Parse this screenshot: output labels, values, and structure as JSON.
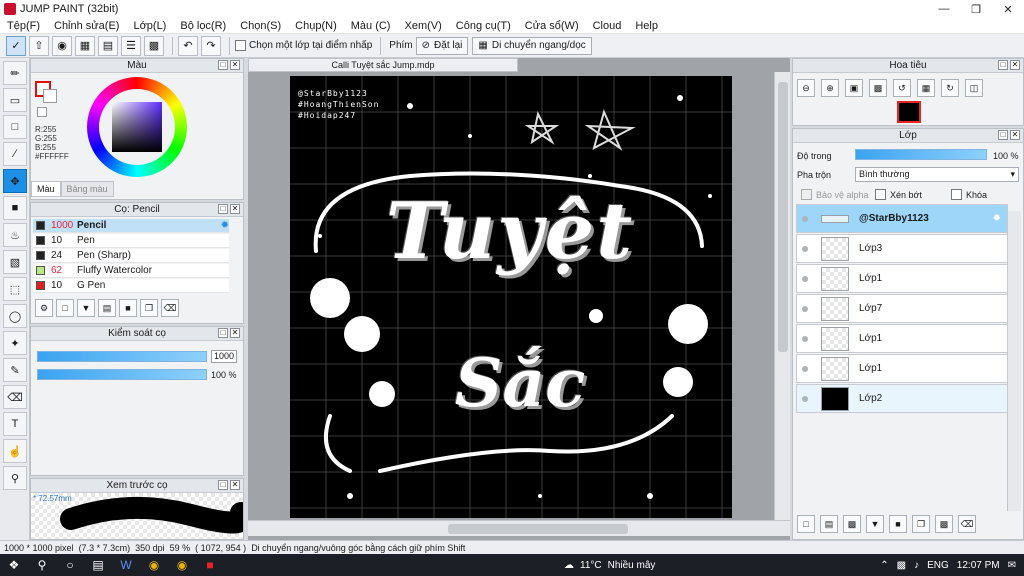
{
  "window": {
    "title": "JUMP PAINT (32bit)"
  },
  "menu": [
    "Tệp(F)",
    "Chỉnh sửa(E)",
    "Lớp(L)",
    "Bộ lọc(R)",
    "Chọn(S)",
    "Chụp(N)",
    "Màu (C)",
    "Xem(V)",
    "Công cụ(T)",
    "Cửa sổ(W)",
    "Cloud",
    "Help"
  ],
  "toolbar": {
    "select_one_layer_label": "Chọn một lớp tại điểm nhấp",
    "pen_label": "Phím",
    "reset_label": "Đặt lại",
    "move_label": "Di chuyển ngang/dọc"
  },
  "color_panel": {
    "title": "Màu",
    "r": "R:255",
    "g": "G:255",
    "b": "B:255",
    "hex": "#FFFFFF",
    "tab_color": "Màu",
    "tab_palette": "Bảng màu"
  },
  "brush_panel": {
    "title": "Cọ: Pencil",
    "items": [
      {
        "size": "1000",
        "name": "Pencil",
        "color": "#222222"
      },
      {
        "size": "10",
        "name": "Pen",
        "color": "#222222"
      },
      {
        "size": "24",
        "name": "Pen (Sharp)",
        "color": "#222222"
      },
      {
        "size": "62",
        "name": "Fluffy Watercolor",
        "color": "#b8e986"
      },
      {
        "size": "10",
        "name": "G Pen",
        "color": "#e02020"
      }
    ]
  },
  "brush_control": {
    "title": "Kiểm soát cọ",
    "size_value": "1000",
    "opacity_value": "100 %",
    "size_fraction": 1.0,
    "opacity_fraction": 1.0
  },
  "brush_preview": {
    "title": "Xem trước cọ",
    "size_mm": "* 72.57mm"
  },
  "document": {
    "tab_title": "Calli Tuyệt sắc Jump.mdp",
    "credits": [
      "@StarBby1123",
      "#HoangThienSon",
      "#Hoidap247"
    ],
    "headline": "Tuyệt",
    "subline": "Sắc"
  },
  "navigator": {
    "title": "Hoa tiêu"
  },
  "layers_panel": {
    "title": "Lớp",
    "opacity_label": "Độ trong",
    "opacity_value": "100 %",
    "opacity_fraction": 1.0,
    "blend_label": "Pha trộn",
    "blend_value": "Bình thường",
    "protect_alpha_label": "Bảo vệ alpha",
    "clipping_label": "Xén bớt",
    "lock_label": "Khóa",
    "layers": [
      {
        "name": "@StarBby1123",
        "thumb": "line"
      },
      {
        "name": "Lớp3",
        "thumb": "transparent"
      },
      {
        "name": "Lớp1",
        "thumb": "transparent"
      },
      {
        "name": "Lớp7",
        "thumb": "transparent"
      },
      {
        "name": "Lớp1",
        "thumb": "transparent"
      },
      {
        "name": "Lớp1",
        "thumb": "transparent"
      },
      {
        "name": "Lớp2",
        "thumb": "black"
      }
    ]
  },
  "status": {
    "dims": "1000 * 1000 pixel",
    "size_cm": "(7.3 * 7.3cm)",
    "dpi": "350 dpi",
    "zoom": "59 %",
    "coords": "( 1072, 954 )",
    "hint": "Di chuyển ngang/vuông góc bằng cách giữ phím Shift"
  },
  "taskbar": {
    "temperature": "11°C",
    "weather": "Nhiều mây",
    "lang": "ENG",
    "time": "12:07 PM"
  },
  "colors": {
    "accent": "#1e8fe6",
    "selection": "#9ed6fa",
    "canvas_bg": "#000000"
  }
}
